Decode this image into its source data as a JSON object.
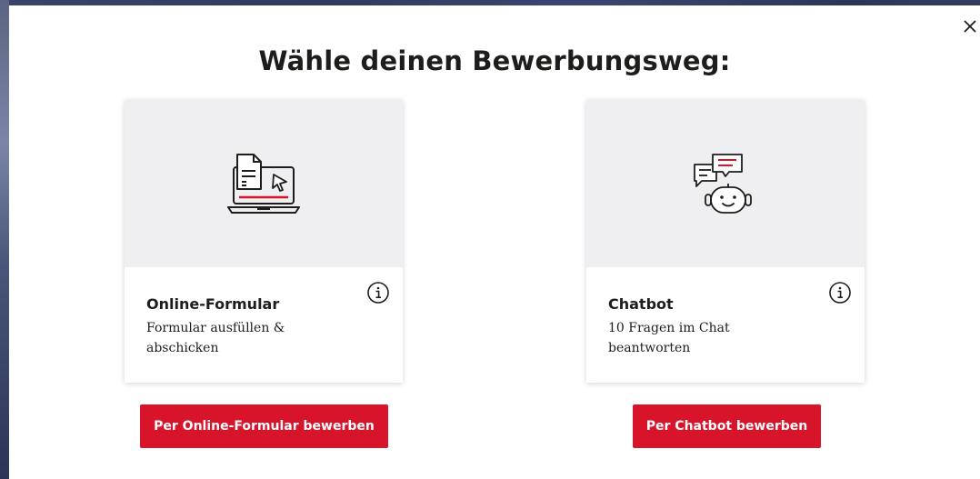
{
  "modal": {
    "title": "Wähle deinen Bewerbungsweg:",
    "close_icon": "close-icon"
  },
  "options": [
    {
      "icon": "laptop-form-icon",
      "title": "Online-Formular",
      "description": "Formular ausfüllen & abschicken",
      "info_icon": "info-icon",
      "button_label": "Per Online-Formular bewerben"
    },
    {
      "icon": "chatbot-icon",
      "title": "Chatbot",
      "description": "10 Fragen im Chat beantworten",
      "info_icon": "info-icon",
      "button_label": "Per Chatbot bewerben"
    }
  ],
  "colors": {
    "accent": "#d7142a",
    "text": "#1d1d1b",
    "card_media_bg": "#efeff1",
    "overlay": "#2b3556"
  }
}
